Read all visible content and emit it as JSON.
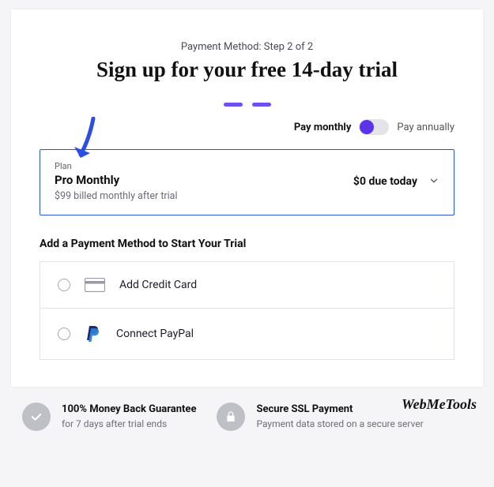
{
  "header": {
    "step_label": "Payment Method: Step 2 of 2",
    "headline": "Sign up for your free 14-day trial"
  },
  "billing_toggle": {
    "monthly_label": "Pay monthly",
    "annually_label": "Pay annually",
    "selected": "monthly"
  },
  "plan": {
    "label": "Plan",
    "name": "Pro Monthly",
    "subtext": "$99 billed monthly after trial",
    "due_text": "$0 due today"
  },
  "payment_methods": {
    "heading": "Add a Payment Method to Start Your Trial",
    "options": [
      {
        "label": "Add Credit Card"
      },
      {
        "label": "Connect PayPal"
      }
    ]
  },
  "footer": {
    "guarantee": {
      "title": "100% Money Back Guarantee",
      "subtitle": "for 7 days after trial ends"
    },
    "security": {
      "title": "Secure SSL Payment",
      "subtitle": "Payment data stored on a secure server"
    },
    "brand": "WebMeTools"
  }
}
